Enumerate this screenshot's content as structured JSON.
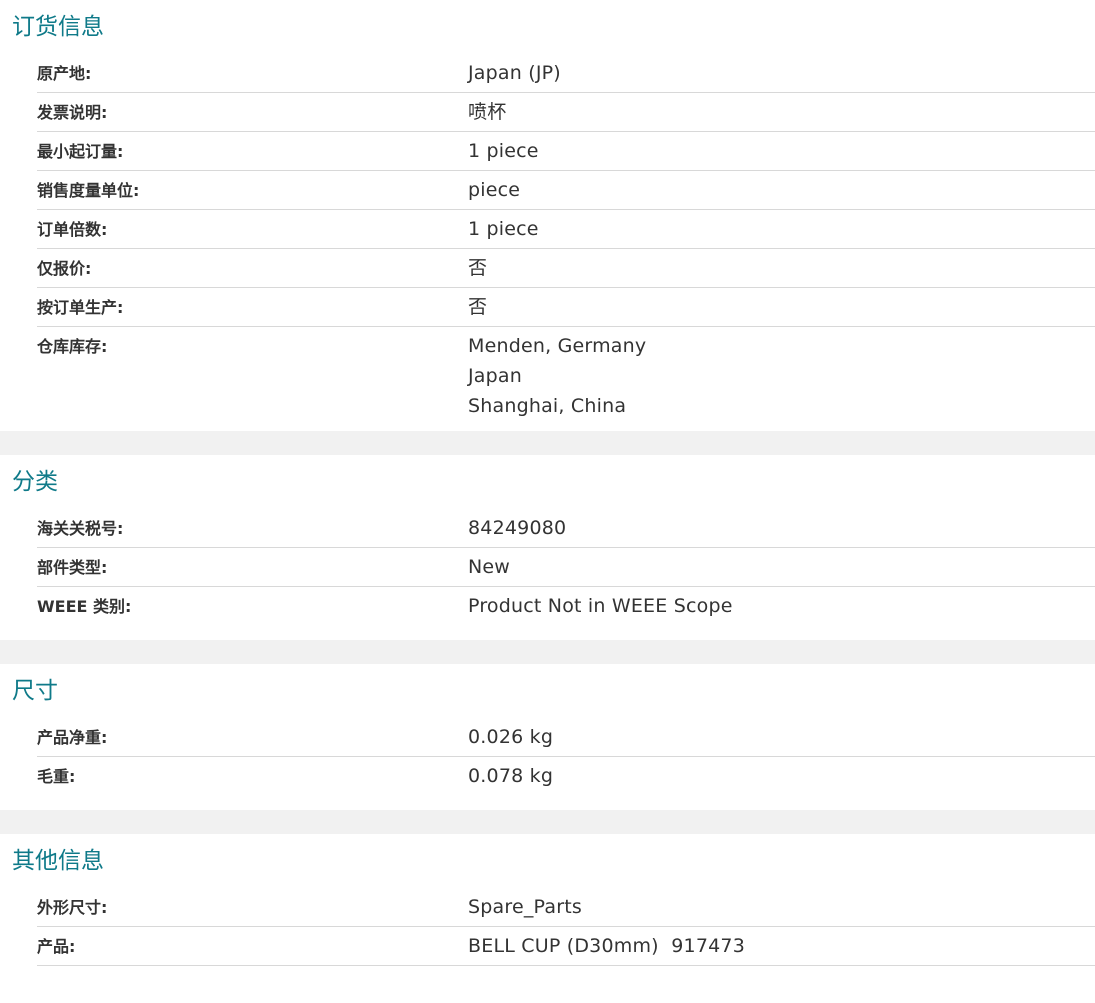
{
  "sections": [
    {
      "title": "订货信息",
      "rows": [
        {
          "label": "原产地:",
          "value": "Japan (JP)"
        },
        {
          "label": "发票说明:",
          "value": "喷杯"
        },
        {
          "label": "最小起订量:",
          "value": "1 piece"
        },
        {
          "label": "销售度量单位:",
          "value": "piece"
        },
        {
          "label": "订单倍数:",
          "value": "1 piece"
        },
        {
          "label": "仅报价:",
          "value": "否"
        },
        {
          "label": "按订单生产:",
          "value": "否"
        },
        {
          "label": "仓库库存:",
          "values": [
            "Menden, Germany",
            "Japan",
            "Shanghai, China"
          ]
        }
      ]
    },
    {
      "title": "分类",
      "rows": [
        {
          "label": "海关关税号:",
          "value": "84249080"
        },
        {
          "label": "部件类型:",
          "value": "New"
        },
        {
          "label": "WEEE 类别:",
          "value": "Product Not in WEEE Scope"
        }
      ]
    },
    {
      "title": "尺寸",
      "rows": [
        {
          "label": "产品净重:",
          "value": "0.026 kg"
        },
        {
          "label": "毛重:",
          "value": "0.078 kg"
        }
      ]
    },
    {
      "title": "其他信息",
      "rows": [
        {
          "label": "外形尺寸:",
          "value": "Spare_Parts"
        },
        {
          "label": "产品:",
          "value": "BELL CUP (D30mm)  917473"
        }
      ]
    }
  ],
  "colors": {
    "heading": "#0f7a89",
    "text": "#333333",
    "divider": "#d8d8d8",
    "section_gap": "#f1f1f1"
  }
}
